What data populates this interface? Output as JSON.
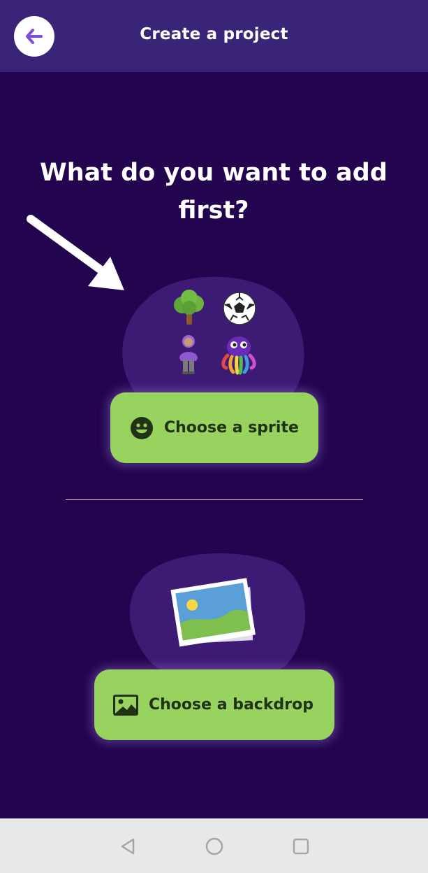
{
  "header": {
    "title": "Create a project",
    "back_icon": "arrow-left-icon"
  },
  "main": {
    "question": "What do you want to add first?",
    "sprite_section": {
      "icons": [
        "tree-icon",
        "soccer-ball-icon",
        "person-icon",
        "octopus-icon"
      ],
      "button_label": "Choose a sprite",
      "button_icon": "smiley-face-icon"
    },
    "backdrop_section": {
      "illustration": "picture-photo-icon",
      "button_label": "Choose a backdrop",
      "button_icon": "image-icon"
    }
  },
  "nav_bar": {
    "items": [
      "back-triangle-icon",
      "home-circle-icon",
      "recents-square-icon"
    ]
  },
  "colors": {
    "background": "#22054e",
    "header": "#3a2478",
    "blob": "#3d1a73",
    "button": "#98d35f",
    "button_text": "#223216",
    "accent": "#7a4fe0"
  }
}
